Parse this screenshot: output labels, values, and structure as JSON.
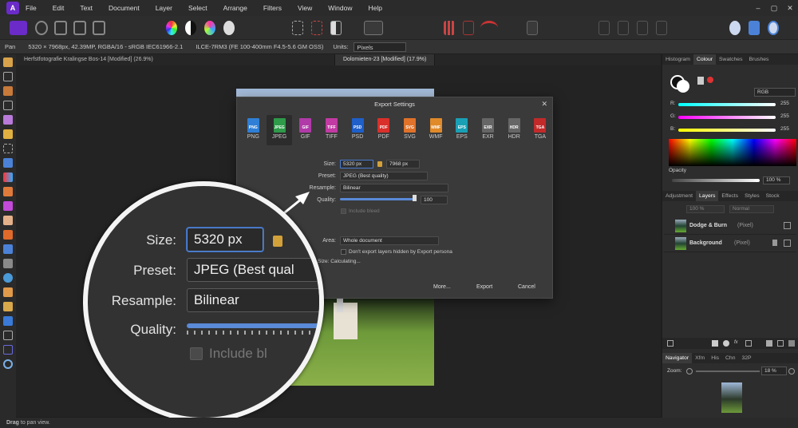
{
  "menu": {
    "items": [
      "File",
      "Edit",
      "Text",
      "Document",
      "Layer",
      "Select",
      "Arrange",
      "Filters",
      "View",
      "Window",
      "Help"
    ],
    "window_controls": [
      "–",
      "▢",
      "✕"
    ]
  },
  "context_bar": {
    "tool": "Pan",
    "doc_info": "5320 × 7968px, 42.39MP, RGBA/16 - sRGB IEC61966-2.1",
    "camera": "ILCE-7RM3 (FE 100-400mm F4.5-5.6 GM OSS)",
    "units_label": "Units:",
    "units_value": "Pixels"
  },
  "tabs": [
    {
      "label": "Herfstfotografie Kralingse Bos-14 [Modified] (26.9%)"
    },
    {
      "label": "Dolomieten-23 [Modified] (17.9%)"
    }
  ],
  "dialog": {
    "title": "Export Settings",
    "formats": [
      {
        "name": "PNG",
        "color": "#2f7fd6"
      },
      {
        "name": "JPEG",
        "color": "#2e9a4a"
      },
      {
        "name": "GIF",
        "color": "#b03aa8"
      },
      {
        "name": "TIFF",
        "color": "#c23aa3"
      },
      {
        "name": "PSD",
        "color": "#1e5fc9"
      },
      {
        "name": "PDF",
        "color": "#d9302b"
      },
      {
        "name": "SVG",
        "color": "#e0722a"
      },
      {
        "name": "WMF",
        "color": "#e08a2a"
      },
      {
        "name": "EPS",
        "color": "#1aa0b5"
      },
      {
        "name": "EXR",
        "color": "#666666"
      },
      {
        "name": "HDR",
        "color": "#666666"
      },
      {
        "name": "TGA",
        "color": "#c22a2a"
      }
    ],
    "size_label": "Size:",
    "size_w": "5320 px",
    "size_h": "7968 px",
    "preset_label": "Preset:",
    "preset_value": "JPEG (Best quality)",
    "resample_label": "Resample:",
    "resample_value": "Bilinear",
    "quality_label": "Quality:",
    "quality_value": "100",
    "include_bleed": "Include bleed",
    "area_label": "Area:",
    "area_value": "Whole document",
    "dont_export": "Don't export layers hidden by Export persona",
    "estimated": "Estimated File Size: Calculating...",
    "more_button": "More...",
    "export_button": "Export",
    "cancel_button": "Cancel"
  },
  "magnifier": {
    "size_label": "Size:",
    "size_value": "5320 px",
    "preset_label": "Preset:",
    "preset_value": "JPEG (Best qual",
    "resample_label": "Resample:",
    "resample_value": "Bilinear",
    "quality_label": "Quality:",
    "include_label": "Include bl"
  },
  "right_panel": {
    "top_tabs": [
      "Histogram",
      "Colour",
      "Swatches",
      "Brushes"
    ],
    "color_mode": "RGB",
    "r_label": "R:",
    "r_value": "255",
    "g_label": "G:",
    "g_value": "255",
    "b_label": "B:",
    "b_value": "255",
    "opacity_label": "Opacity",
    "opacity_value": "100 %",
    "layer_tabs": [
      "Adjustment",
      "Layers",
      "Effects",
      "Styles",
      "Stock"
    ],
    "layer_opacity": "100 %",
    "blend_mode": "Normal",
    "layers": [
      {
        "name": "Dodge & Burn",
        "kind": "(Pixel)"
      },
      {
        "name": "Background",
        "kind": "(Pixel)"
      }
    ],
    "nav_tabs": [
      "Navigator",
      "Xfm",
      "His",
      "Chn",
      "32P"
    ],
    "zoom_label": "Zoom:",
    "zoom_value": "18 %"
  },
  "status": {
    "bold": "Drag",
    "text": " to pan view."
  }
}
